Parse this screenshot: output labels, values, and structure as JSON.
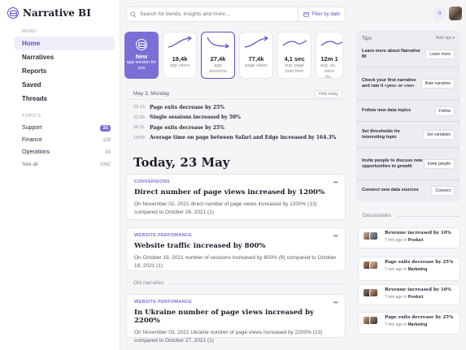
{
  "app": {
    "name": "Narrative BI"
  },
  "sidebar": {
    "menu_label": "MENU",
    "menu": [
      "Home",
      "Narratives",
      "Reports",
      "Saved",
      "Threads"
    ],
    "topics_label": "TOPICS",
    "topics": [
      {
        "label": "Support",
        "count": "31"
      },
      {
        "label": "Finance",
        "count": "119"
      },
      {
        "label": "Operations",
        "count": "43"
      },
      {
        "label": "See all",
        "count": "1062"
      }
    ]
  },
  "topbar": {
    "search_placeholder": "Search for trends, insights and more...",
    "filter_label": "Filter by date",
    "notifications": "0"
  },
  "cards": {
    "new": {
      "title": "New",
      "subtitle": "app version for you"
    },
    "metrics": [
      {
        "value": "19,4k",
        "label": "app users"
      },
      {
        "value": "27,4k",
        "label": "app sessions"
      },
      {
        "value": "77,4k",
        "label": "page views"
      },
      {
        "value": "4,1 sec",
        "label": "avg. page load time"
      },
      {
        "value": "12m 1",
        "label": "avg. se... ssion du..."
      }
    ]
  },
  "yesterday": {
    "date": "May 3, Monday",
    "hide_label": "Hide today",
    "items": [
      {
        "time": "22:13",
        "text": "Page exits decrease by 25%"
      },
      {
        "time": "21:09",
        "text": "Single sessions increased by 50%"
      },
      {
        "time": "18:11",
        "text": "Page exits decrease by 25%"
      },
      {
        "time": "14:59",
        "text": "Average time on page between Safari and Edge increased by 164.3%"
      }
    ]
  },
  "today": {
    "heading": "Today, 23 May"
  },
  "narratives": [
    {
      "category": "CONVERSIONS",
      "title": "Direct number of page views increased by 1200%",
      "body": "On November 02, 2021 direct number of page views increased by 1200% (13) compared to October 26, 2021 (1)"
    },
    {
      "category": "WEBSITE PERFOMANCE",
      "title": "Website traffic increased by 800%",
      "body": "On October 19, 2021 number of sessions increased by 800% (9) compared to October 18, 2021 (1)"
    },
    {
      "category": "WEBSITE PERFOMANCE",
      "title": "In Ukraine number of page views increased by 2200%",
      "body": "On November 03, 2021 Ukraine number of page views increased by 2200% (23) compared to October 27, 2021 (1)"
    }
  ],
  "old_label": "Old narraties",
  "tips": {
    "title": "Tips",
    "hide_label": "Hide tips",
    "items": [
      {
        "text": "Learn more about Narrative BI",
        "button": "Learn more"
      },
      {
        "text": "Check your first narrative and rate it «yes» or «no»",
        "button": "Rate narrative"
      },
      {
        "text": "Follow new data topics",
        "button": "Follow"
      },
      {
        "text": "Set thresholds for interesting topic",
        "button": "Set variables"
      },
      {
        "text": "Invite people to discuss new opportunities to growth",
        "button": "Invite people"
      },
      {
        "text": "Connect new data sources",
        "button": "Connect"
      }
    ]
  },
  "discussions": {
    "label": "Discussions",
    "items": [
      {
        "title": "Revenue increased by 10%",
        "time": "7 min ago in",
        "topic": "Product"
      },
      {
        "title": "Page exits decrease by 25%",
        "time": "7 min ago in",
        "topic": "Marketing"
      },
      {
        "title": "Revenue increased by 10%",
        "time": "7 min ago in",
        "topic": "Product"
      },
      {
        "title": "Page exits decrease by 25%",
        "time": "7 min ago in",
        "topic": "Marketing"
      }
    ]
  },
  "colors": {
    "accent": "#7a6fd6",
    "accent_dark": "#5b4fc4",
    "background": "#f5f5f7"
  }
}
